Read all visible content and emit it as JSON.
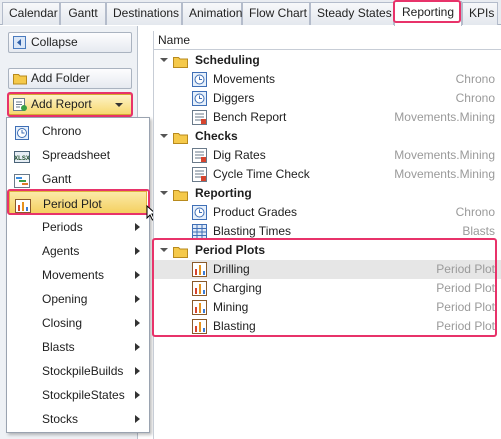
{
  "tabs": [
    "Calendar",
    "Gantt",
    "Destinations",
    "Animation",
    "Flow Chart",
    "Steady States",
    "Reporting",
    "KPIs"
  ],
  "active_tab": "Reporting",
  "left_panel": {
    "collapse_label": "Collapse",
    "add_folder_label": "Add Folder",
    "add_report_label": "Add Report"
  },
  "menu": {
    "items": [
      {
        "label": "Chrono",
        "icon": "clock-icon",
        "submenu": false
      },
      {
        "label": "Spreadsheet",
        "icon": "xlsx-icon",
        "submenu": false
      },
      {
        "label": "Gantt",
        "icon": "gantt-icon",
        "submenu": false
      },
      {
        "label": "Period Plot",
        "icon": "period-plot-icon",
        "submenu": false,
        "selected": true
      },
      {
        "label": "Periods",
        "submenu": true
      },
      {
        "label": "Agents",
        "submenu": true
      },
      {
        "label": "Movements",
        "submenu": true
      },
      {
        "label": "Opening",
        "submenu": true
      },
      {
        "label": "Closing",
        "submenu": true
      },
      {
        "label": "Blasts",
        "submenu": true
      },
      {
        "label": "StockpileBuilds",
        "submenu": true
      },
      {
        "label": "StockpileStates",
        "submenu": true
      },
      {
        "label": "Stocks",
        "submenu": true
      }
    ]
  },
  "tree": {
    "column_header": "Name",
    "groups": [
      {
        "label": "Scheduling",
        "items": [
          {
            "label": "Movements",
            "type": "Chrono",
            "icon": "clock-icon"
          },
          {
            "label": "Diggers",
            "type": "Chrono",
            "icon": "clock-icon"
          },
          {
            "label": "Bench Report",
            "type": "Movements.Mining",
            "icon": "report-icon"
          }
        ]
      },
      {
        "label": "Checks",
        "items": [
          {
            "label": "Dig Rates",
            "type": "Movements.Mining",
            "icon": "report-icon"
          },
          {
            "label": "Cycle Time Check",
            "type": "Movements.Mining",
            "icon": "report-icon"
          }
        ]
      },
      {
        "label": "Reporting",
        "items": [
          {
            "label": "Product Grades",
            "type": "Chrono",
            "icon": "clock-icon"
          },
          {
            "label": "Blasting Times",
            "type": "Blasts",
            "icon": "table-icon"
          }
        ]
      },
      {
        "label": "Period Plots",
        "items": [
          {
            "label": "Drilling",
            "type": "Period Plot",
            "icon": "period-plot-icon",
            "selected": true
          },
          {
            "label": "Charging",
            "type": "Period Plot",
            "icon": "period-plot-icon"
          },
          {
            "label": "Mining",
            "type": "Period Plot",
            "icon": "period-plot-icon"
          },
          {
            "label": "Blasting",
            "type": "Period Plot",
            "icon": "period-plot-icon"
          }
        ]
      }
    ]
  },
  "colors": {
    "highlight": "#e8336a",
    "accent": "#f4cf5d"
  }
}
